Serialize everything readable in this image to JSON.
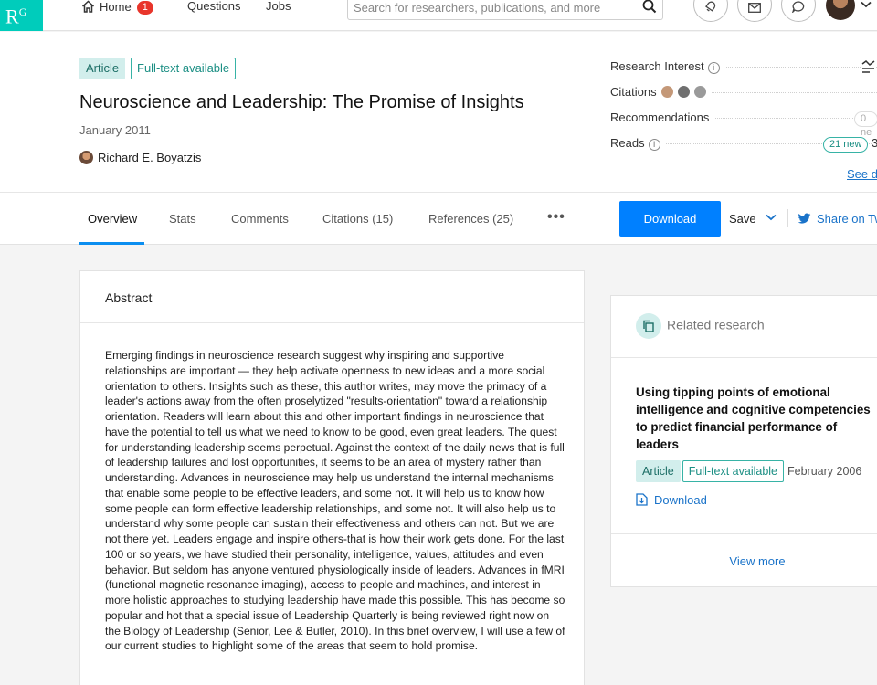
{
  "nav": {
    "logo": "R",
    "logo_sup": "G",
    "home_label": "Home",
    "home_badge": "1",
    "questions_label": "Questions",
    "jobs_label": "Jobs",
    "search_placeholder": "Search for researchers, publications, and more"
  },
  "publication": {
    "type_tag": "Article",
    "fulltext_tag": "Full-text available",
    "title": "Neuroscience and Leadership: The Promise of Insights",
    "date": "January 2011",
    "author": "Richard E. Boyatzis"
  },
  "stats": {
    "research_interest_label": "Research Interest",
    "citations_label": "Citations",
    "recommendations_label": "Recommendations",
    "recommendations_pill": "0 ne",
    "reads_label": "Reads",
    "reads_pill": "21 new",
    "reads_value": "3",
    "see_details": "See d"
  },
  "tabs": {
    "overview": "Overview",
    "stats": "Stats",
    "comments": "Comments",
    "citations": "Citations (15)",
    "references": "References (25)",
    "more": "•••"
  },
  "actions": {
    "download": "Download",
    "save": "Save",
    "share": "Share on Tw"
  },
  "abstract": {
    "heading": "Abstract",
    "text": "Emerging findings in neuroscience research suggest why inspiring and supportive relationships are important — they help activate openness to new ideas and a more social orientation to others. Insights such as these, this author writes, may move the primacy of a leader's actions away from the often proselytized \"results-orientation\" toward a relationship orientation. Readers will learn about this and other important findings in neuroscience that have the potential to tell us what we need to know to be good, even great leaders. The quest for understanding leadership seems perpetual. Against the context of the daily news that is full of leadership failures and lost opportunities, it seems to be an area of mystery rather than understanding. Advances in neuroscience may help us understand the internal mechanisms that enable some people to be effective leaders, and some not. It will help us to know how some people can form effective leadership relationships, and some not. It will also help us to understand why some people can sustain their effectiveness and others can not. But we are not there yet. Leaders engage and inspire others-that is how their work gets done. For the last 100 or so years, we have studied their personality, intelligence, values, attitudes and even behavior. But seldom has anyone ventured physiologically inside of leaders. Advances in fMRI (functional magnetic resonance imaging), access to people and machines, and interest in more holistic approaches to studying leadership have made this possible. This has become so popular and hot that a special issue of Leadership Quarterly is being reviewed right now on the Biology of Leadership (Senior, Lee & Butler, 2010). In this brief overview, I will use a few of our current studies to highlight some of the areas that seem to hold promise."
  },
  "related": {
    "heading": "Related research",
    "item_title": "Using tipping points of emotional intelligence and cognitive competencies to predict financial performance of leaders",
    "item_type": "Article",
    "item_fulltext": "Full-text available",
    "item_date": "February 2006",
    "item_download": "Download",
    "view_more": "View more"
  },
  "colors": {
    "brand": "#00ccbb",
    "primary": "#0080ff",
    "link": "#1a73c9",
    "badge": "#e8352b"
  }
}
